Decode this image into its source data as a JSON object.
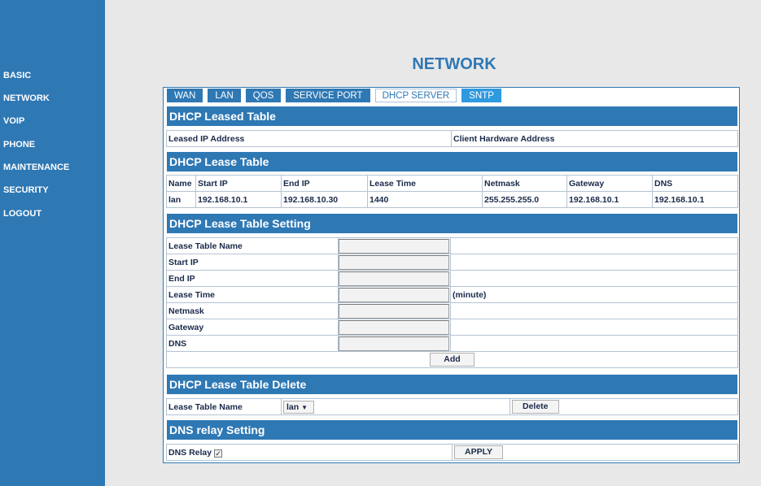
{
  "sidebar": {
    "items": [
      {
        "label": "BASIC"
      },
      {
        "label": "NETWORK"
      },
      {
        "label": "VOIP"
      },
      {
        "label": "PHONE"
      },
      {
        "label": "MAINTENANCE"
      },
      {
        "label": "SECURITY"
      },
      {
        "label": "LOGOUT"
      }
    ]
  },
  "page": {
    "title": "NETWORK"
  },
  "tabs": [
    {
      "label": "WAN"
    },
    {
      "label": "LAN"
    },
    {
      "label": "QOS"
    },
    {
      "label": "SERVICE PORT"
    },
    {
      "label": "DHCP SERVER",
      "active": true
    },
    {
      "label": "SNTP"
    }
  ],
  "leased_table": {
    "title": "DHCP Leased Table",
    "headers": [
      "Leased IP Address",
      "Client Hardware Address"
    ]
  },
  "lease_table": {
    "title": "DHCP Lease Table",
    "headers": [
      "Name",
      "Start IP",
      "End IP",
      "Lease Time",
      "Netmask",
      "Gateway",
      "DNS"
    ],
    "rows": [
      [
        "lan",
        "192.168.10.1",
        "192.168.10.30",
        "1440",
        "255.255.255.0",
        "192.168.10.1",
        "192.168.10.1"
      ]
    ]
  },
  "lease_setting": {
    "title": "DHCP Lease Table Setting",
    "fields": [
      {
        "label": "Lease Table Name",
        "value": ""
      },
      {
        "label": "Start IP",
        "value": ""
      },
      {
        "label": "End IP",
        "value": ""
      },
      {
        "label": "Lease Time",
        "value": "",
        "suffix": "(minute)"
      },
      {
        "label": "Netmask",
        "value": ""
      },
      {
        "label": "Gateway",
        "value": ""
      },
      {
        "label": "DNS",
        "value": ""
      }
    ],
    "add_label": "Add"
  },
  "lease_delete": {
    "title": "DHCP Lease Table Delete",
    "label": "Lease Table Name",
    "selected": "lan",
    "delete_label": "Delete"
  },
  "dns_relay": {
    "title": "DNS relay Setting",
    "label": "DNS Relay",
    "checked": true,
    "apply_label": "APPLY"
  },
  "colors": {
    "accent": "#2e78b4",
    "tab_sntp": "#2e9ae0",
    "background": "#e8e8e8"
  }
}
